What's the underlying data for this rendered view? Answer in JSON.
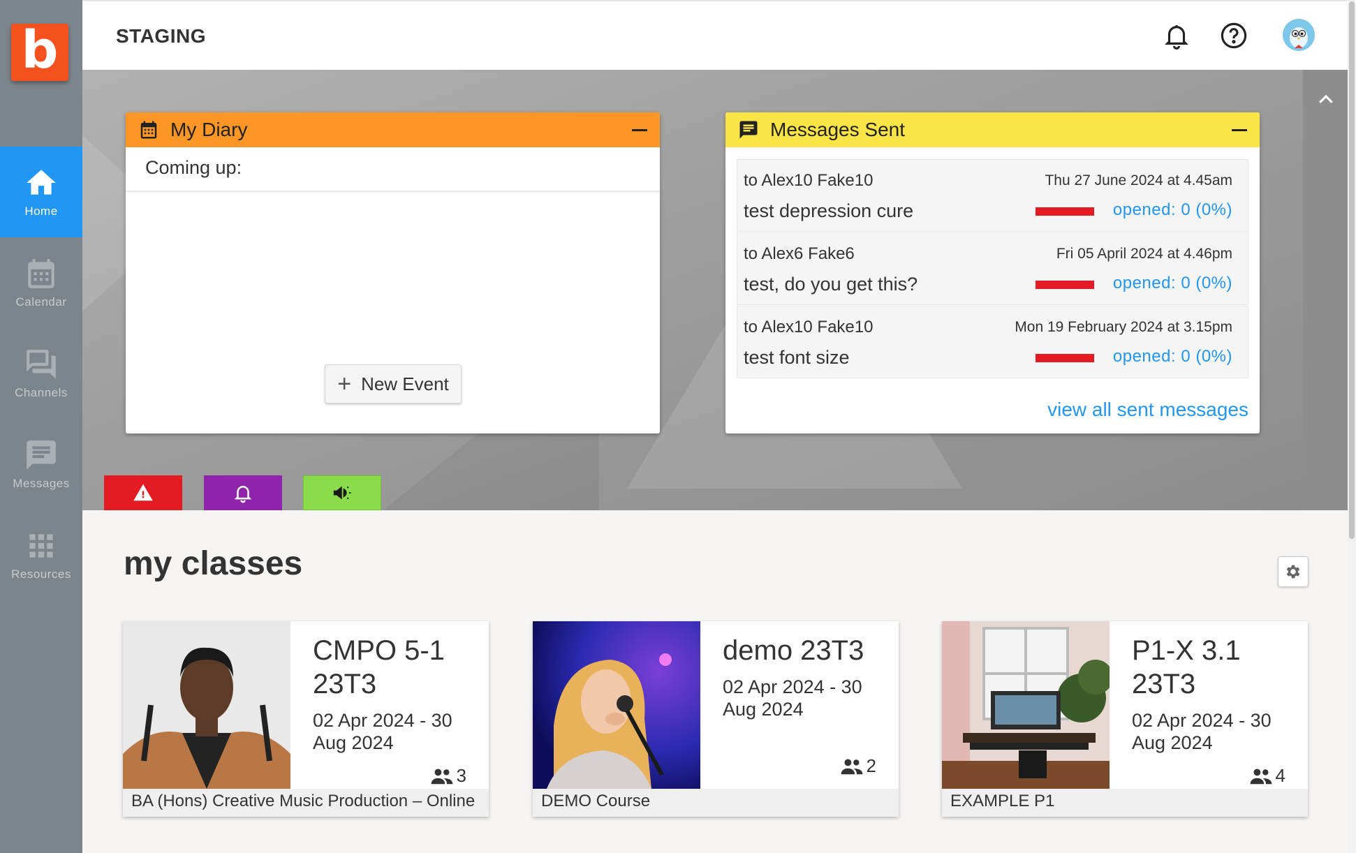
{
  "app": {
    "title": "STAGING",
    "logo_letter": "b"
  },
  "sidebar": {
    "items": [
      {
        "label": "Home",
        "icon": "home-icon",
        "active": true
      },
      {
        "label": "Calendar",
        "icon": "calendar-icon",
        "active": false
      },
      {
        "label": "Channels",
        "icon": "channels-icon",
        "active": false
      },
      {
        "label": "Messages",
        "icon": "messages-icon",
        "active": false
      },
      {
        "label": "Resources",
        "icon": "resources-icon",
        "active": false
      }
    ]
  },
  "header": {
    "icons": [
      "bell-icon",
      "help-icon",
      "avatar"
    ]
  },
  "diary": {
    "title": "My Diary",
    "coming_up": "Coming up:",
    "new_event_label": "New Event",
    "color": "#fb9627"
  },
  "messages_sent": {
    "title": "Messages Sent",
    "color": "#fbe546",
    "rows": [
      {
        "to": "to Alex10 Fake10",
        "date": "Thu 27 June 2024 at 4.45am",
        "subject": "test depression cure",
        "opened": "opened:  0  (0%)"
      },
      {
        "to": "to Alex6 Fake6",
        "date": "Fri 05 April 2024 at 4.46pm",
        "subject": "test, do you get this?",
        "opened": "opened:  0  (0%)"
      },
      {
        "to": "to Alex10 Fake10",
        "date": "Mon 19 February 2024 at 3.15pm",
        "subject": "test font size",
        "opened": "opened:  0  (0%)"
      }
    ],
    "view_all_label": "view all sent messages"
  },
  "notification_tabs": [
    {
      "icon": "warning-icon",
      "color": "#e31b23"
    },
    {
      "icon": "bell-icon",
      "color": "#8e24aa"
    },
    {
      "icon": "megaphone-icon",
      "color": "#8bdc4a"
    }
  ],
  "classes": {
    "title": "my classes",
    "cards": [
      {
        "name": "CMPO 5-1 23T3",
        "dates": "02 Apr 2024 - 30 Aug 2024",
        "count": "3",
        "course": "BA (Hons) Creative Music Production – Online"
      },
      {
        "name": "demo 23T3",
        "dates": "02 Apr 2024 - 30 Aug 2024",
        "count": "2",
        "course": "DEMO Course"
      },
      {
        "name": "P1-X 3.1 23T3",
        "dates": "02 Apr 2024 - 30 Aug 2024",
        "count": "4",
        "course": "EXAMPLE P1"
      }
    ]
  }
}
